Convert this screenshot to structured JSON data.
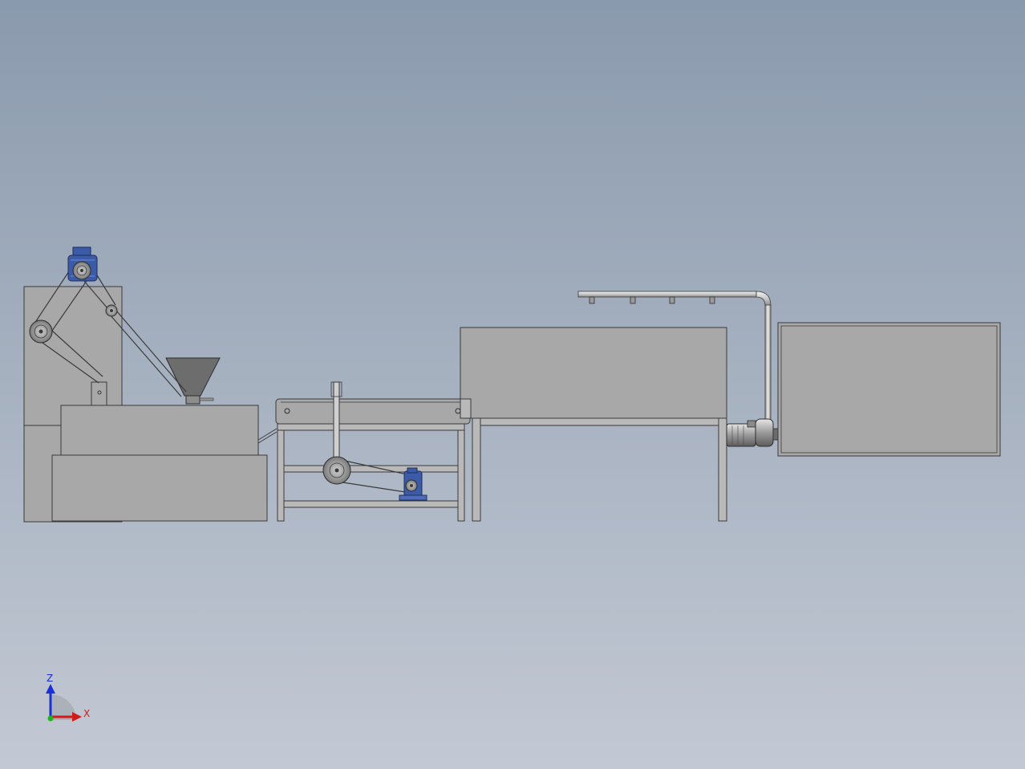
{
  "viewport": {
    "background_top": "#8a9aad",
    "background_bottom": "#c3c9d4"
  },
  "triad": {
    "z_label": "Z",
    "x_label": "X",
    "z_color": "#1b2fd9",
    "x_color": "#d11a1a",
    "y_color": "#18b818"
  },
  "colors": {
    "body_fill": "#a8a8a8",
    "body_stroke": "#3a3a3a",
    "frame_fill": "#b9b9b9",
    "motor_blue": "#3b5aa8",
    "motor_light": "#6f8ed6",
    "hopper_fill": "#6d6d6d"
  }
}
